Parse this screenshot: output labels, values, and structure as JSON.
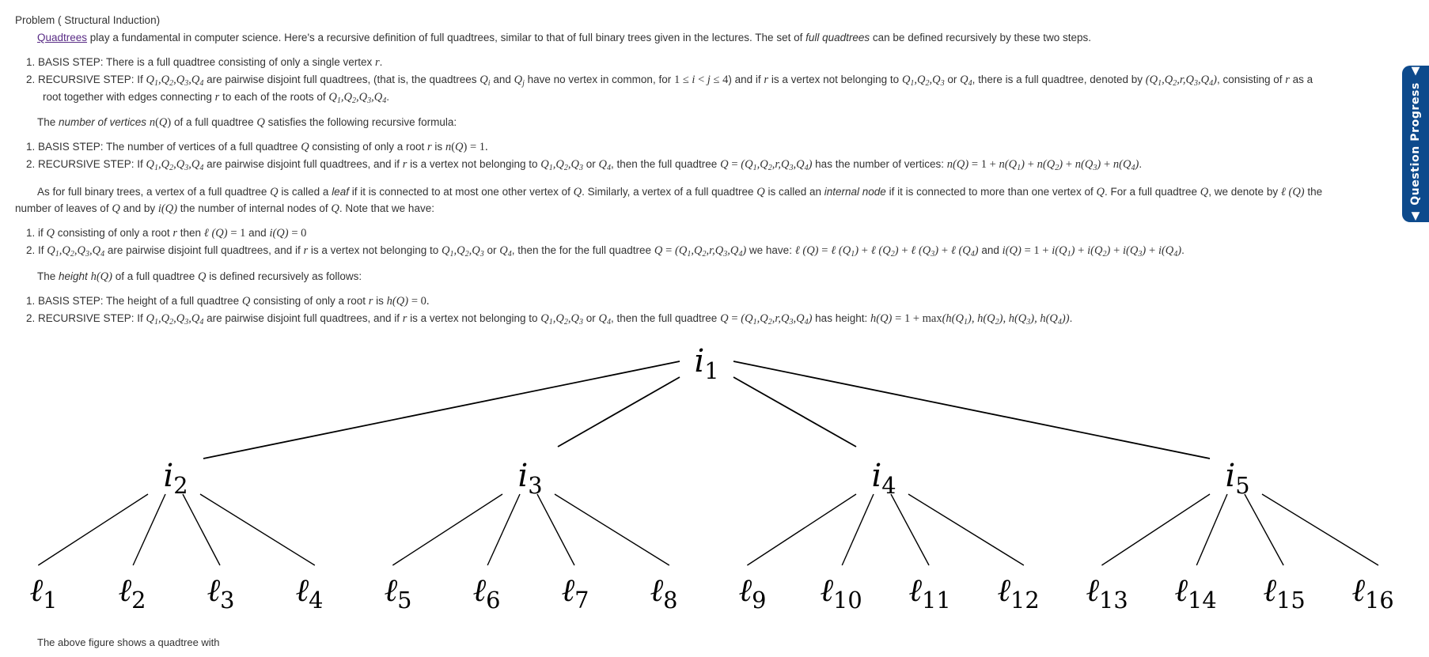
{
  "problem": {
    "title": "Problem ( Structural Induction)",
    "intro": {
      "link": "Quadtrees",
      "text1": " play a fundamental in computer science. Here's a recursive definition of full quadtrees, similar to that of full binary trees given in the lectures. The set of ",
      "em": "full quadtrees",
      "text2": " can be defined recursively by these two steps."
    },
    "definition_steps": [
      "1. BASIS STEP: There is a full quadtree consisting of only a single vertex r.",
      "2. RECURSIVE STEP: If Q1,Q2,Q3,Q4 are pairwise disjoint full quadtrees, (that is, the quadtrees Qi and Qj have no vertex in common, for 1 ≤ i < j ≤ 4) and if r is a vertex not belonging to Q1,Q2,Q3 or Q4, there is a full quadtree, denoted by (Q1,Q2,r,Q3,Q4), consisting of r as a root together with edges connecting r to each of the roots of Q1,Q2,Q3,Q4."
    ],
    "vertices_intro": "The number of vertices n(Q) of a full quadtree Q satisfies the following recursive formula:",
    "vertices_steps": [
      "1. BASIS STEP: The number of vertices of a full quadtree Q consisting of only a root r is n(Q) = 1.",
      "2. RECURSIVE STEP: If Q1,Q2,Q3,Q4 are pairwise disjoint full quadtrees, and if r is a vertex not belonging to Q1,Q2,Q3 or Q4, then the full quadtree Q = (Q1,Q2,r,Q3,Q4) has the number of vertices: n(Q) = 1 + n(Q1) + n(Q2) + n(Q3) + n(Q4)."
    ],
    "leaf_paragraph": "As for full binary trees, a vertex of a full quadtree Q is called a leaf if it is connected to at most one other vertex of Q. Similarly, a vertex of a full quadtree Q is called an internal node if it is connected to more than one vertex of Q. For a full quadtree Q, we denote by ℓ(Q) the number of leaves of Q and by i(Q) the number of internal nodes of Q. Note that we have:",
    "leaf_steps": [
      "1. if Q consisting of only a root r then ℓ(Q) = 1 and i(Q) = 0",
      "2. If Q1,Q2,Q3,Q4 are pairwise disjoint full quadtrees, and if r is a vertex not belonging to Q1,Q2,Q3 or Q4, then the for the full quadtree Q = (Q1,Q2,r,Q3,Q4) we have: ℓ(Q) = ℓ(Q1) + ℓ(Q2) + ℓ(Q3) + ℓ(Q4) and i(Q) = 1 + i(Q1) + i(Q2) + i(Q3) + i(Q4)."
    ],
    "height_intro": "The height h(Q) of a full quadtree Q is defined recursively as follows:",
    "height_steps": [
      "1. BASIS STEP: The height of a full quadtree Q consisting of only a root r is h(Q) = 0.",
      "2. RECURSIVE STEP: If Q1,Q2,Q3,Q4 are pairwise disjoint full quadtrees, and if r is a vertex not belonging to Q1,Q2,Q3 or Q4, then the full quadtree Q = (Q1,Q2,r,Q3,Q4) has height: h(Q) = 1 + max(h(Q1), h(Q2), h(Q3), h(Q4))."
    ],
    "caption": "The above figure shows a quadtree with"
  },
  "tree": {
    "root": {
      "name": "i",
      "sub": "1"
    },
    "internal": [
      {
        "name": "i",
        "sub": "2",
        "leaves": [
          {
            "name": "ℓ",
            "sub": "1"
          },
          {
            "name": "ℓ",
            "sub": "2"
          },
          {
            "name": "ℓ",
            "sub": "3"
          },
          {
            "name": "ℓ",
            "sub": "4"
          }
        ]
      },
      {
        "name": "i",
        "sub": "3",
        "leaves": [
          {
            "name": "ℓ",
            "sub": "5"
          },
          {
            "name": "ℓ",
            "sub": "6"
          },
          {
            "name": "ℓ",
            "sub": "7"
          },
          {
            "name": "ℓ",
            "sub": "8"
          }
        ]
      },
      {
        "name": "i",
        "sub": "4",
        "leaves": [
          {
            "name": "ℓ",
            "sub": "9"
          },
          {
            "name": "ℓ",
            "sub": "10"
          },
          {
            "name": "ℓ",
            "sub": "11"
          },
          {
            "name": "ℓ",
            "sub": "12"
          }
        ]
      },
      {
        "name": "i",
        "sub": "5",
        "leaves": [
          {
            "name": "ℓ",
            "sub": "13"
          },
          {
            "name": "ℓ",
            "sub": "14"
          },
          {
            "name": "ℓ",
            "sub": "15"
          },
          {
            "name": "ℓ",
            "sub": "16"
          }
        ]
      }
    ]
  },
  "sidebar": {
    "question_progress_label": "▲ Question Progress ▲",
    "color": "#0d4a8c"
  }
}
